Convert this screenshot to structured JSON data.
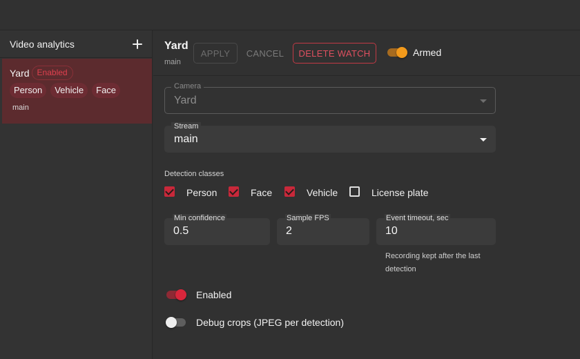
{
  "sidebar": {
    "title": "Video analytics",
    "watches": [
      {
        "name": "Yard",
        "status": "Enabled",
        "classes": [
          "Person",
          "Vehicle",
          "Face"
        ],
        "stream": "main"
      }
    ]
  },
  "header": {
    "title": "Yard",
    "subtitle": "main",
    "apply_label": "APPLY",
    "cancel_label": "CANCEL",
    "delete_label": "DELETE WATCH",
    "armed_label": "Armed",
    "armed": true
  },
  "form": {
    "camera": {
      "label": "Camera",
      "value": "Yard",
      "disabled": true
    },
    "stream": {
      "label": "Stream",
      "value": "main"
    },
    "detection_label": "Detection classes",
    "classes": [
      {
        "label": "Person",
        "checked": true
      },
      {
        "label": "Face",
        "checked": true
      },
      {
        "label": "Vehicle",
        "checked": true
      },
      {
        "label": "License plate",
        "checked": false
      }
    ],
    "min_confidence": {
      "label": "Min confidence",
      "value": "0.5"
    },
    "sample_fps": {
      "label": "Sample FPS",
      "value": "2"
    },
    "event_timeout": {
      "label": "Event timeout, sec",
      "value": "10",
      "helper": "Recording kept after the last detection"
    },
    "enabled": {
      "label": "Enabled",
      "on": true
    },
    "debug_crops": {
      "label": "Debug crops (JPEG per detection)",
      "on": false
    }
  },
  "colors": {
    "accent_red": "#d8263b",
    "armed_orange": "#f39a1b",
    "selected_row": "#5c2b2e"
  }
}
